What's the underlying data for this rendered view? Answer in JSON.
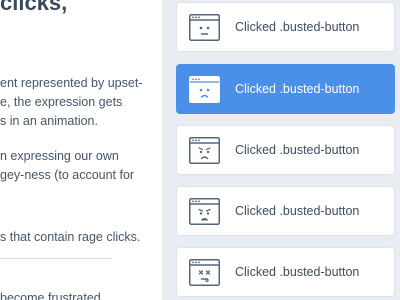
{
  "article": {
    "heading": "clicks,",
    "paragraph1": [
      "ent represented by upset-",
      "e, the expression gets",
      "s in an animation."
    ],
    "paragraph2": [
      "n expressing our own",
      "gey-ness (to account for"
    ],
    "paragraph3": "s that contain rage clicks.",
    "paragraph4": "become frustrated"
  },
  "events": [
    {
      "label": "Clicked .busted-button",
      "icon": "neutral-face-window-icon",
      "active": false
    },
    {
      "label": "Clicked .busted-button",
      "icon": "sad-face-window-icon",
      "active": true
    },
    {
      "label": "Clicked .busted-button",
      "icon": "frown-face-window-icon",
      "active": false
    },
    {
      "label": "Clicked .busted-button",
      "icon": "upset-face-window-icon",
      "active": false
    },
    {
      "label": "Clicked .busted-button",
      "icon": "dead-face-window-icon",
      "active": false
    }
  ],
  "colors": {
    "accent": "#4a8fe8",
    "panel_background": "#e9edf3",
    "text": "#3e4d60"
  }
}
